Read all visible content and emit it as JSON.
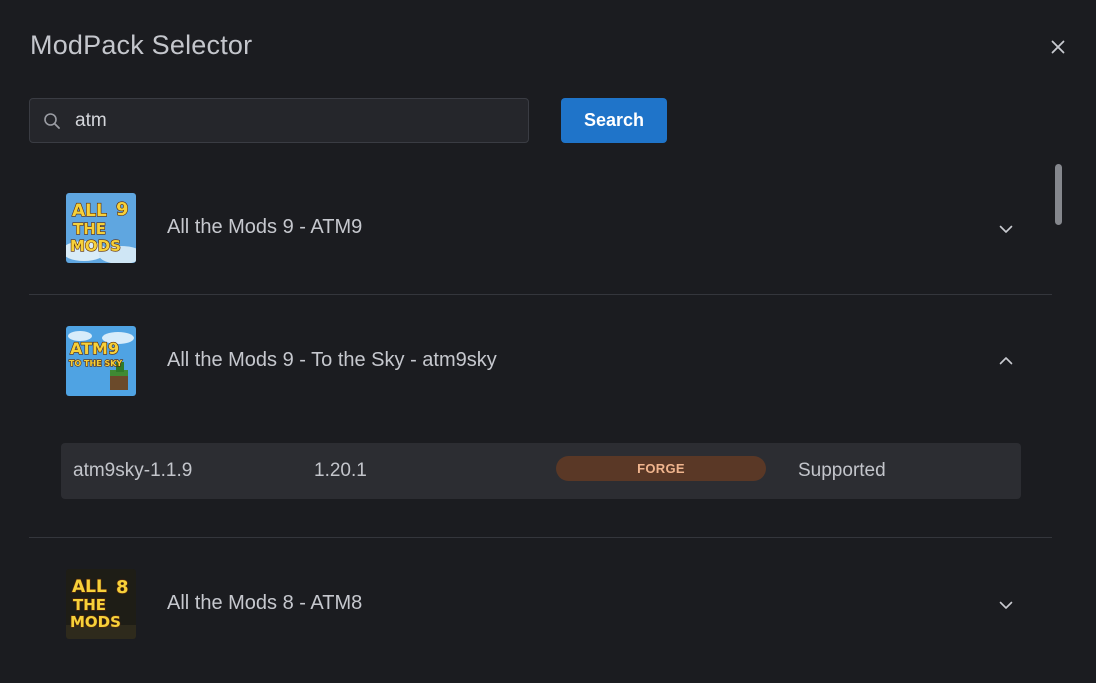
{
  "dialog": {
    "title": "ModPack Selector",
    "close_icon": "close-icon"
  },
  "search": {
    "icon": "search-icon",
    "value": "atm",
    "button_label": "Search"
  },
  "packs": [
    {
      "name": "All the Mods 9 - ATM9",
      "thumbnail_text": [
        "ALL",
        "THE",
        "MODS",
        "9"
      ],
      "expanded": false,
      "chevron": "chevron-down-icon"
    },
    {
      "name": "All the Mods 9 - To the Sky - atm9sky",
      "thumbnail_text": [
        "ATM9",
        "TO THE SKY"
      ],
      "expanded": true,
      "chevron": "chevron-up-icon",
      "versions": [
        {
          "version": "atm9sky-1.1.9",
          "minecraft": "1.20.1",
          "loader": "FORGE",
          "status": "Supported"
        }
      ]
    },
    {
      "name": "All the Mods 8 - ATM8",
      "thumbnail_text": [
        "ALL",
        "THE",
        "MODS",
        "8"
      ],
      "expanded": false,
      "chevron": "chevron-down-icon"
    }
  ],
  "colors": {
    "background": "#1b1c20",
    "accent": "#1f74c9",
    "forge_badge_bg": "#5a3826",
    "forge_badge_text": "#f0b58e"
  }
}
